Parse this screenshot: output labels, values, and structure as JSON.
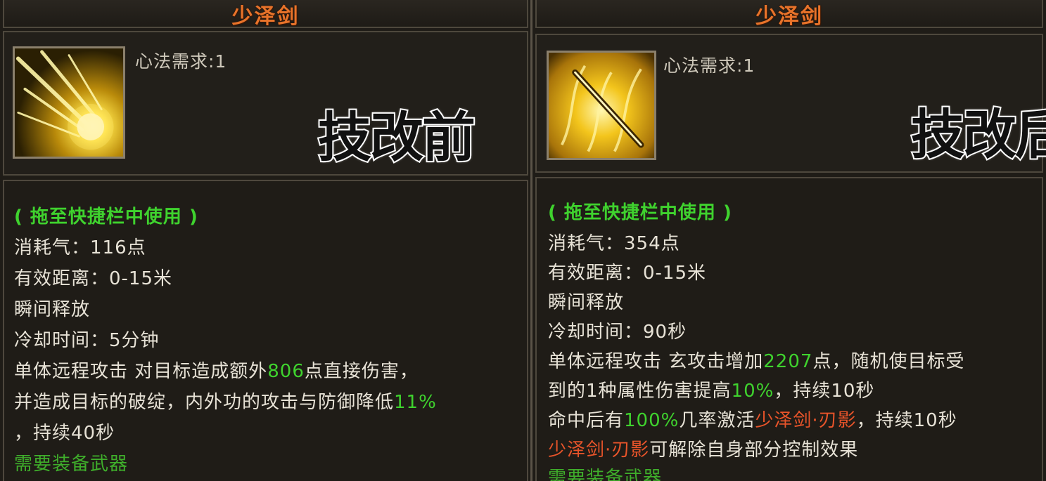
{
  "left": {
    "title": "少泽剑",
    "requirement": "心法需求:1",
    "badge": "技改前",
    "hint": "( 拖至快捷栏中使用 )",
    "cost": "消耗气：116点",
    "range": "有效距离：0-15米",
    "cast": "瞬间释放",
    "cooldown": "冷却时间：5分钟",
    "desc1_a": "单体远程攻击 对目标造成额外",
    "desc1_v": "806",
    "desc1_b": "点直接伤害，",
    "desc2_a": "并造成目标的破绽，内外功的攻击与防御降低",
    "desc2_v": "11%",
    "desc3": "，持续40秒",
    "need": "需要装备武器"
  },
  "right": {
    "title": "少泽剑",
    "requirement": "心法需求:1",
    "badge": "技改后",
    "hint": "( 拖至快捷栏中使用 )",
    "cost": "消耗气：354点",
    "range": "有效距离：0-15米",
    "cast": "瞬间释放",
    "cooldown": "冷却时间：90秒",
    "desc1_a": "单体远程攻击 玄攻击增加",
    "desc1_v": "2207",
    "desc1_b": "点，随机使目标受",
    "desc2_a": "到的1种属性伤害提高",
    "desc2_v": "10%",
    "desc2_b": "，持续10秒",
    "desc3_a": "命中后有",
    "desc3_v": "100%",
    "desc3_b": "几率激活",
    "desc3_skill": "少泽剑·刃影",
    "desc3_c": "，持续10秒",
    "desc4_skill": "少泽剑·刃影",
    "desc4_b": "可解除自身部分控制效果",
    "need": "需要装备武器"
  },
  "colors": {
    "title": "#e8732a",
    "highlight_green": "#3fd22e",
    "skill_orange": "#e8542a",
    "text": "#e7e2d6"
  },
  "icons": {
    "left": "golden-meteor-sword-icon",
    "right": "golden-blade-slash-icon"
  }
}
